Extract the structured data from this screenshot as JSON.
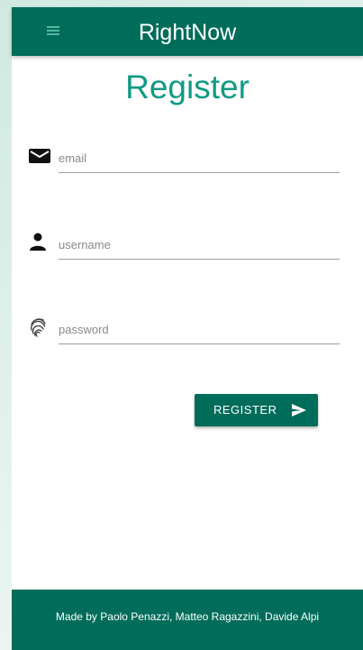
{
  "navbar": {
    "title": "RightNow",
    "menu_icon": "hamburger-menu-icon"
  },
  "page": {
    "title": "Register"
  },
  "form": {
    "email": {
      "placeholder": "email",
      "value": "",
      "icon": "envelope-icon"
    },
    "username": {
      "placeholder": "username",
      "value": "",
      "icon": "person-icon"
    },
    "password": {
      "placeholder": "password",
      "value": "",
      "icon": "fingerprint-icon"
    },
    "submit": {
      "label": "REGISTER",
      "icon": "send-icon"
    }
  },
  "footer": {
    "text": "Made by Paolo Penazzi, Matteo Ragazzini, Davide Alpi"
  },
  "colors": {
    "primary": "#006c5a",
    "title": "#129a84",
    "menu_icon": "#55b7a1"
  }
}
